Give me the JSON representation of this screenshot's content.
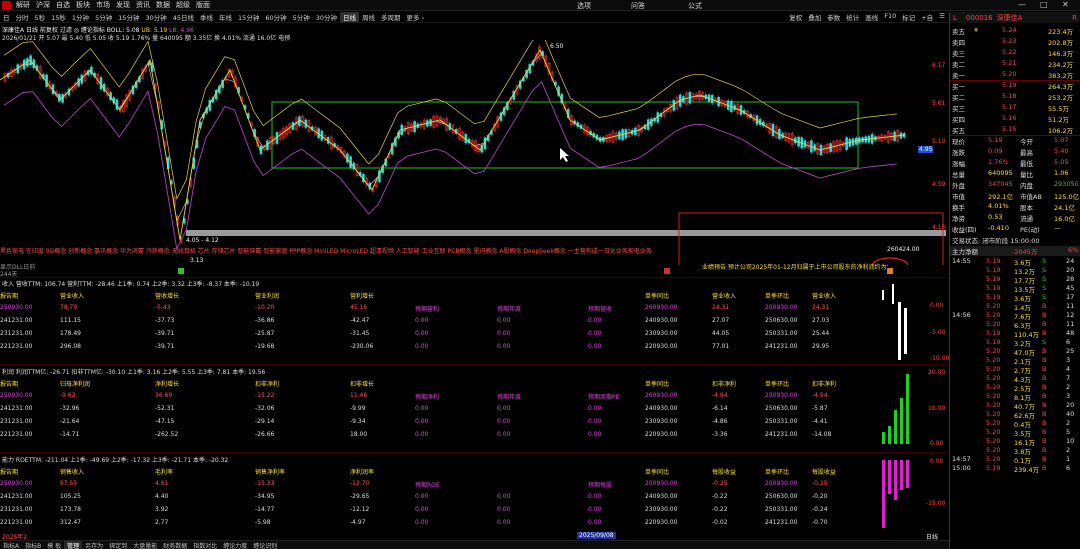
{
  "menubar": {
    "items": [
      "解研",
      "沪深",
      "自选",
      "板块",
      "市场",
      "发现",
      "资讯",
      "数据",
      "超级",
      "版面"
    ],
    "center_tabs": [
      "选项",
      "问答",
      "公式"
    ],
    "winctl": [
      "—",
      "□",
      "✕"
    ]
  },
  "periodbar": {
    "items": [
      "日",
      "分时",
      "5秒",
      "15秒",
      "1分钟",
      "5分钟",
      "15分钟",
      "30分钟",
      "45日线",
      "季线",
      "年线",
      "15分钟",
      "60分钟",
      "5分钟",
      "30分钟",
      "日线",
      "周线",
      "多周期",
      "更多 ›"
    ],
    "active_index": 15,
    "right_items": [
      "复权",
      "叠加",
      "参数",
      "统计",
      "画线",
      "F10",
      "标记",
      "+自",
      "☰"
    ]
  },
  "stock_header": {
    "title": "深康佳A 日线 前复权 过滤 ◎ 缠论指标 BOLL: 5.08",
    "ub": "UB: 5.19",
    "lb": "LB: 4.96",
    "line2": "2026/01/21 开 5.07 最 5.40 低 5.05 收 5.19 1.76%   量 640095 额 3.35亿 换 4.01% 流通 16.0亿 电预"
  },
  "price_axis": [
    "6.17",
    "5.61",
    "5.10",
    "4.59",
    "4.15"
  ],
  "price_markers": {
    "high": "6.50",
    "low": "3.13",
    "range": "4.05 - 4.12",
    "marker_195": "4.95"
  },
  "concepts": "黑色家电 在印度 5G概念 创新概念 氢讯概念 华为鸿蒙 汽热概念 无线耳机 芯片 存储芯片 智能穿戴 智能家居 PPP概念 MiniLED MicroLED 超清视频 人工智能 工业互联 PCB概念 星闪概念 A股概念 DeepSeek概念 一主营构成一日化业务家电业务",
  "concept_value": "260424.00",
  "sub_line": "显示DLL日前",
  "sub_line2": "244天",
  "notice": "业绩预告 预计公司2025年01-12月归属于上市公司股东的净利润约为亏损...",
  "panels": [
    {
      "title": "收入 营收TTM: 106.74  营利TTM: -28.46  上1季: 0.74  上2季: 3.32  上3季: -8.37  本季: -10.19",
      "headers": [
        "报告期",
        "营业收入",
        "营收增长",
        "营业利润",
        "营利增长",
        "",
        "",
        "",
        "单季同比",
        "营业收入",
        "单季环比",
        "营业收入"
      ],
      "rows": [
        [
          "250930.00",
          "78.79",
          "-5.43",
          "-10.20",
          "45.16",
          "预期营利",
          "预期年度",
          "预期营收",
          "260930.00",
          "24.31",
          "250930.00",
          "24.31"
        ],
        [
          "241231.00",
          "111.15",
          "-37.73",
          "-36.86",
          "-42.47",
          "0.00",
          "0.00",
          "0.00",
          "240930.00",
          "27.07",
          "250630.00",
          "27.03"
        ],
        [
          "231231.00",
          "178.49",
          "-39.71",
          "-25.87",
          "-31.45",
          "0.00",
          "0.00",
          "0.00",
          "230930.00",
          "44.05",
          "250331.00",
          "25.44"
        ],
        [
          "221231.00",
          "296.08",
          "-39.71",
          "-19.68",
          "-230.06",
          "0.00",
          "0.00",
          "0.00",
          "220930.00",
          "77.01",
          "241231.00",
          "29.95"
        ]
      ]
    },
    {
      "title": "利润 利润TTM亿: -26.71  扣非TTM亿: -30.10  上1季: 3.16  上2季: 5.55  上3季: 7.81  本季: 19.56",
      "headers": [
        "报告期",
        "归母净利润",
        "净利增长",
        "扣非净利",
        "扣非增长",
        "",
        "",
        "",
        "单季同比",
        "扣非净利",
        "单季环比",
        "扣非净利"
      ],
      "rows": [
        [
          "250930.00",
          "-9.62",
          "36.69",
          "-15.22",
          "11.46",
          "预期净利",
          "预期年度",
          "预期周期PE",
          "260930.00",
          "-4.94",
          "250930.00",
          "-4.94"
        ],
        [
          "241231.00",
          "-32.96",
          "-52.31",
          "-32.06",
          "-9.99",
          "0.00",
          "0.00",
          "0.00",
          "240930.00",
          "-6.14",
          "250630.00",
          "-5.87"
        ],
        [
          "231231.00",
          "-21.64",
          "-47.15",
          "-29.14",
          "-9.34",
          "0.00",
          "0.00",
          "0.00",
          "230930.00",
          "-4.86",
          "250331.00",
          "-4.41"
        ],
        [
          "221231.00",
          "-14.71",
          "-262.52",
          "-26.66",
          "18.00",
          "0.00",
          "0.00",
          "0.00",
          "220930.00",
          "-3.36",
          "241231.00",
          "-14.08"
        ]
      ]
    },
    {
      "title": "能力 ROETTM: -211.04  上1季: -49.69  上2季: -17.32  上3季: -21.71  本季: -20.32",
      "headers": [
        "报告期",
        "销售收入",
        "毛利率",
        "销售净利率",
        "净利润率",
        "",
        "",
        "",
        "单季同比",
        "每股收益",
        "单季环比",
        "每股收益"
      ],
      "rows": [
        [
          "250930.00",
          "67.55",
          "4.61",
          "-15.33",
          "-12.70",
          "预期ROE",
          "",
          "预期每股",
          "250930.00",
          "-0.25",
          "250930.00",
          "-0.25"
        ],
        [
          "241231.00",
          "105.25",
          "4.40",
          "-34.95",
          "-29.65",
          "0.00",
          "0.00",
          "0.00",
          "240930.00",
          "-0.22",
          "250630.00",
          "-0.20"
        ],
        [
          "231231.00",
          "173.78",
          "3.92",
          "-14.77",
          "-12.12",
          "0.00",
          "0.00",
          "0.00",
          "230930.00",
          "-0.22",
          "250331.00",
          "-0.24"
        ],
        [
          "221231.00",
          "312.47",
          "2.77",
          "-5.98",
          "-4.97",
          "0.00",
          "0.00",
          "0.00",
          "220930.00",
          "-0.02",
          "241231.00",
          "-0.70"
        ]
      ]
    }
  ],
  "panel_axes": [
    [
      "0.00",
      "-5.00",
      "-10.00"
    ],
    [
      "20.00",
      "10.00",
      "0.00"
    ],
    [
      "0.00",
      "-15.00"
    ]
  ],
  "date_bar": {
    "left": "2025年2",
    "mid": "2025/09/08",
    "right": "日线"
  },
  "bottombar": [
    "指标A",
    "指标B",
    "模 板",
    "管理",
    "另存为",
    "绑定到",
    "大盘量能",
    "财务数据",
    "指数对比",
    "缠论力度",
    "缠论识别"
  ],
  "bottom_active": 3,
  "right_panel": {
    "header_left": "L",
    "code": "000016",
    "name": "深康佳A",
    "header_right": "R",
    "asks": [
      {
        "label": "卖五",
        "tag": "¥",
        "price": "5.24",
        "vol": "223.4万"
      },
      {
        "label": "卖四",
        "tag": "",
        "price": "5.23",
        "vol": "202.8万"
      },
      {
        "label": "卖三",
        "tag": "",
        "price": "5.22",
        "vol": "146.3万"
      },
      {
        "label": "卖二",
        "tag": "",
        "price": "5.21",
        "vol": "234.2万"
      },
      {
        "label": "卖一",
        "tag": "",
        "price": "5.20",
        "vol": "383.2万"
      }
    ],
    "bids": [
      {
        "label": "买一",
        "price": "5.19",
        "vol": "264.3万"
      },
      {
        "label": "买二",
        "price": "5.18",
        "vol": "253.2万"
      },
      {
        "label": "买三",
        "price": "5.17",
        "vol": "55.5万"
      },
      {
        "label": "买四",
        "price": "5.16",
        "vol": "51.2万"
      },
      {
        "label": "买五",
        "price": "5.15",
        "vol": "106.2万"
      }
    ],
    "stats": [
      {
        "k1": "现价",
        "v1": "5.19",
        "k2": "今开",
        "v2": "5.07"
      },
      {
        "k1": "涨跌",
        "v1": "0.09",
        "k2": "最高",
        "v2": "5.40"
      },
      {
        "k1": "涨幅",
        "v1": "1.76%",
        "k2": "最低",
        "v2": "5.05"
      },
      {
        "k1": "总量",
        "v1": "640095",
        "k2": "量比",
        "v2": "1.06"
      },
      {
        "k1": "外盘",
        "v1": "347045",
        "k2": "内盘",
        "v2": "293050"
      },
      {
        "k1": "市值",
        "v1": "292.1亿",
        "k2": "市值AB",
        "v2": "125.0亿"
      },
      {
        "k1": "换手",
        "v1": "4.01%",
        "k2": "股本",
        "v2": "24.1亿"
      },
      {
        "k1": "净资",
        "v1": "0.53",
        "k2": "流通",
        "v2": "16.0亿"
      },
      {
        "k1": "收益(四)",
        "v1": "-0.410",
        "k2": "PE(动)",
        "v2": "—"
      }
    ],
    "trade_status": "交易状态: 闭市阶段 15:00:00",
    "mainflow": {
      "label": "主力净额",
      "value": "-2045万",
      "pct": "6%"
    },
    "ticks": [
      {
        "t": "14:55",
        "p": "5.19",
        "v": "3.6万",
        "s": "S",
        "n": "24"
      },
      {
        "t": "",
        "p": "5.19",
        "v": "13.2万",
        "s": "S",
        "n": "20"
      },
      {
        "t": "",
        "p": "5.19",
        "v": "17.7万",
        "s": "S",
        "n": "28"
      },
      {
        "t": "",
        "p": "5.19",
        "v": "13.5万",
        "s": "S",
        "n": "45"
      },
      {
        "t": "",
        "p": "5.19",
        "v": "3.6万",
        "s": "S",
        "n": "17"
      },
      {
        "t": "",
        "p": "5.20",
        "v": "1.4万",
        "s": "B",
        "n": "11"
      },
      {
        "t": "14:56",
        "p": "5.20",
        "v": "7.6万",
        "s": "B",
        "n": "12"
      },
      {
        "t": "",
        "p": "5.20",
        "v": "6.3万",
        "s": "B",
        "n": "11"
      },
      {
        "t": "",
        "p": "5.19",
        "v": "110.4万",
        "s": "B",
        "n": "48"
      },
      {
        "t": "",
        "p": "5.19",
        "v": "3.2万",
        "s": "S",
        "n": "6"
      },
      {
        "t": "",
        "p": "5.20",
        "v": "47.0万",
        "s": "B",
        "n": "25"
      },
      {
        "t": "",
        "p": "5.20",
        "v": "2.1万",
        "s": "B",
        "n": "3"
      },
      {
        "t": "",
        "p": "5.20",
        "v": "2.7万",
        "s": "B",
        "n": "4"
      },
      {
        "t": "",
        "p": "5.20",
        "v": "4.3万",
        "s": "B",
        "n": "7"
      },
      {
        "t": "",
        "p": "5.20",
        "v": "2.5万",
        "s": "B",
        "n": "2"
      },
      {
        "t": "",
        "p": "5.20",
        "v": "8.1万",
        "s": "B",
        "n": "3"
      },
      {
        "t": "",
        "p": "5.20",
        "v": "40.7万",
        "s": "B",
        "n": "20"
      },
      {
        "t": "",
        "p": "5.20",
        "v": "62.6万",
        "s": "B",
        "n": "40"
      },
      {
        "t": "",
        "p": "5.20",
        "v": "0.4万",
        "s": "B",
        "n": "2"
      },
      {
        "t": "",
        "p": "5.20",
        "v": "3.5万",
        "s": "B",
        "n": "5"
      },
      {
        "t": "",
        "p": "5.20",
        "v": "16.1万",
        "s": "B",
        "n": "10"
      },
      {
        "t": "",
        "p": "5.20",
        "v": "3.8万",
        "s": "B",
        "n": "2"
      },
      {
        "t": "14:57",
        "p": "5.20",
        "v": "0.1万",
        "s": "B",
        "n": "1"
      },
      {
        "t": "15:00",
        "p": "5.19",
        "v": "239.4万",
        "s": "B",
        "n": "6"
      }
    ]
  },
  "colors": {
    "up": "#ff3030",
    "down": "#20d020",
    "ma_yellow": "#e8d040",
    "purple": "#b040c0",
    "green_box": "#20c020",
    "red_box": "#d02020"
  }
}
